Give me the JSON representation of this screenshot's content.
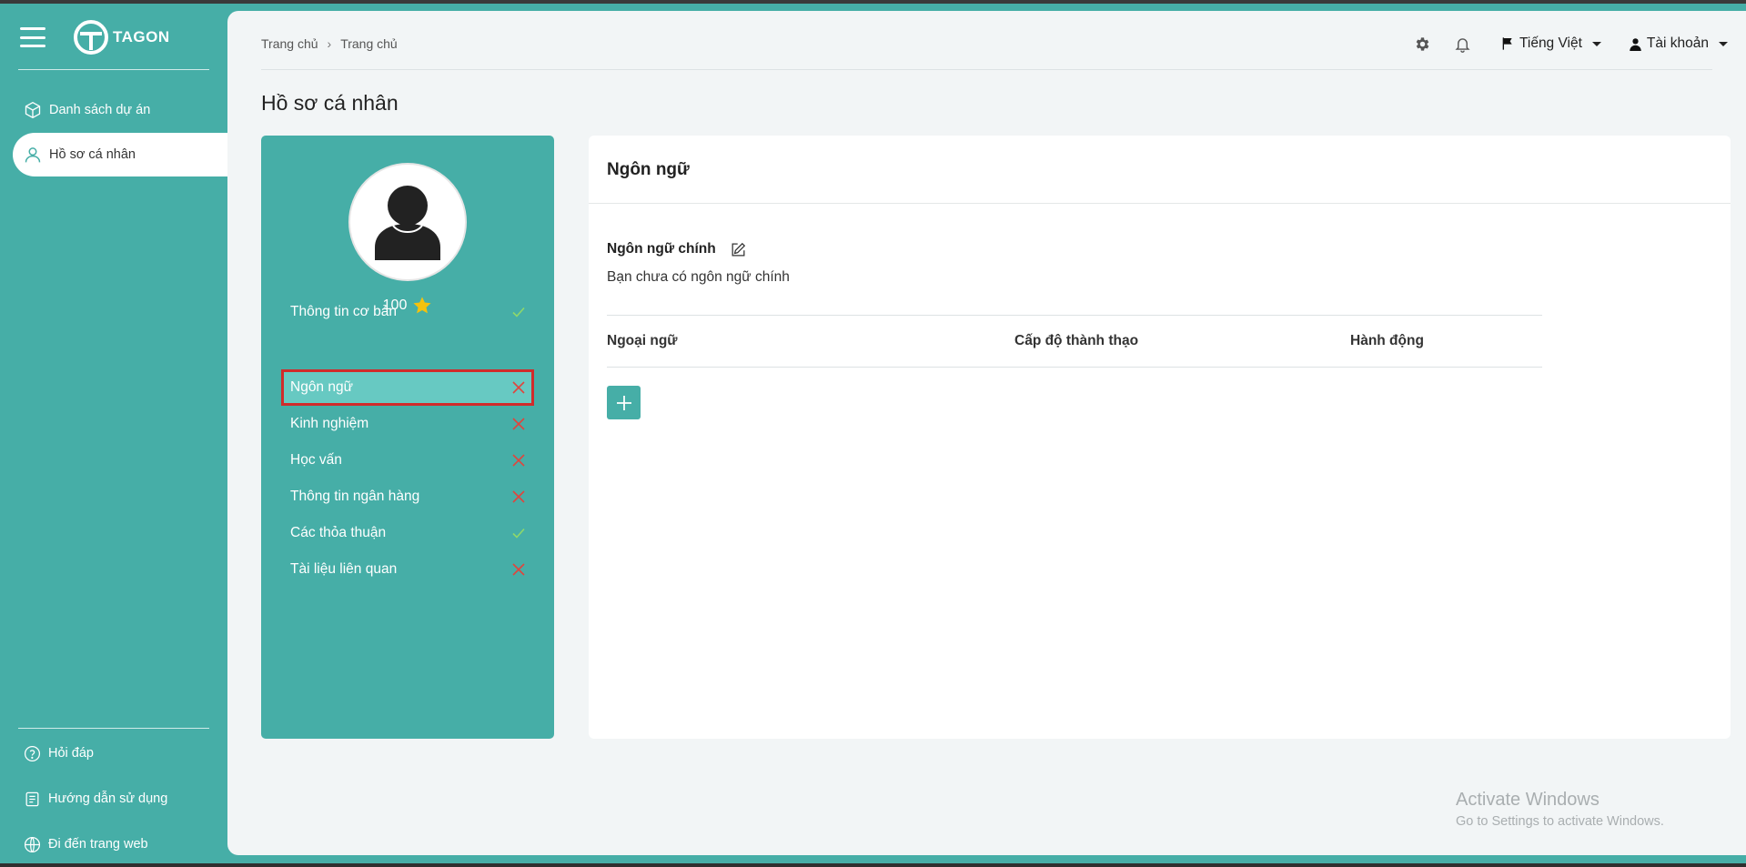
{
  "app": {
    "logo_text": "TAGON"
  },
  "sidebar": {
    "nav": [
      {
        "label": "Danh sách dự án",
        "icon": "cube-icon"
      },
      {
        "label": "Hồ sơ cá nhân",
        "icon": "user-icon",
        "active": true
      }
    ],
    "bottom": [
      {
        "label": "Hỏi đáp",
        "icon": "question-circle-icon"
      },
      {
        "label": "Hướng dẫn sử dụng",
        "icon": "document-icon"
      },
      {
        "label": "Đi đến trang web",
        "icon": "globe-icon"
      }
    ]
  },
  "header": {
    "breadcrumb": [
      "Trang chủ",
      "Trang chủ"
    ],
    "language": "Tiếng Việt",
    "account": "Tài khoản"
  },
  "page": {
    "title": "Hồ sơ cá nhân"
  },
  "profile": {
    "points": "100",
    "items": [
      {
        "label": "Thông tin cơ bản",
        "status": "done"
      },
      {
        "label": "Ngôn ngữ",
        "status": "missing",
        "active": true
      },
      {
        "label": "Kinh nghiệm",
        "status": "missing"
      },
      {
        "label": "Học vấn",
        "status": "missing"
      },
      {
        "label": "Thông tin ngân hàng",
        "status": "missing"
      },
      {
        "label": "Các thỏa thuận",
        "status": "done"
      },
      {
        "label": "Tài liệu liên quan",
        "status": "missing"
      }
    ]
  },
  "content": {
    "title": "Ngôn ngữ",
    "main_language_label": "Ngôn ngữ chính",
    "empty_text": "Bạn chưa có ngôn ngữ chính",
    "table_headers": [
      "Ngoại ngữ",
      "Cấp độ thành thạo",
      "Hành động"
    ]
  },
  "watermark": {
    "line1": "Activate Windows",
    "line2": "Go to Settings to activate Windows."
  },
  "colors": {
    "brand": "#46aea7",
    "active_item": "#67c9c2",
    "highlight_border": "#d12b2b",
    "check": "#8fd86a",
    "cross": "#e0453d"
  }
}
